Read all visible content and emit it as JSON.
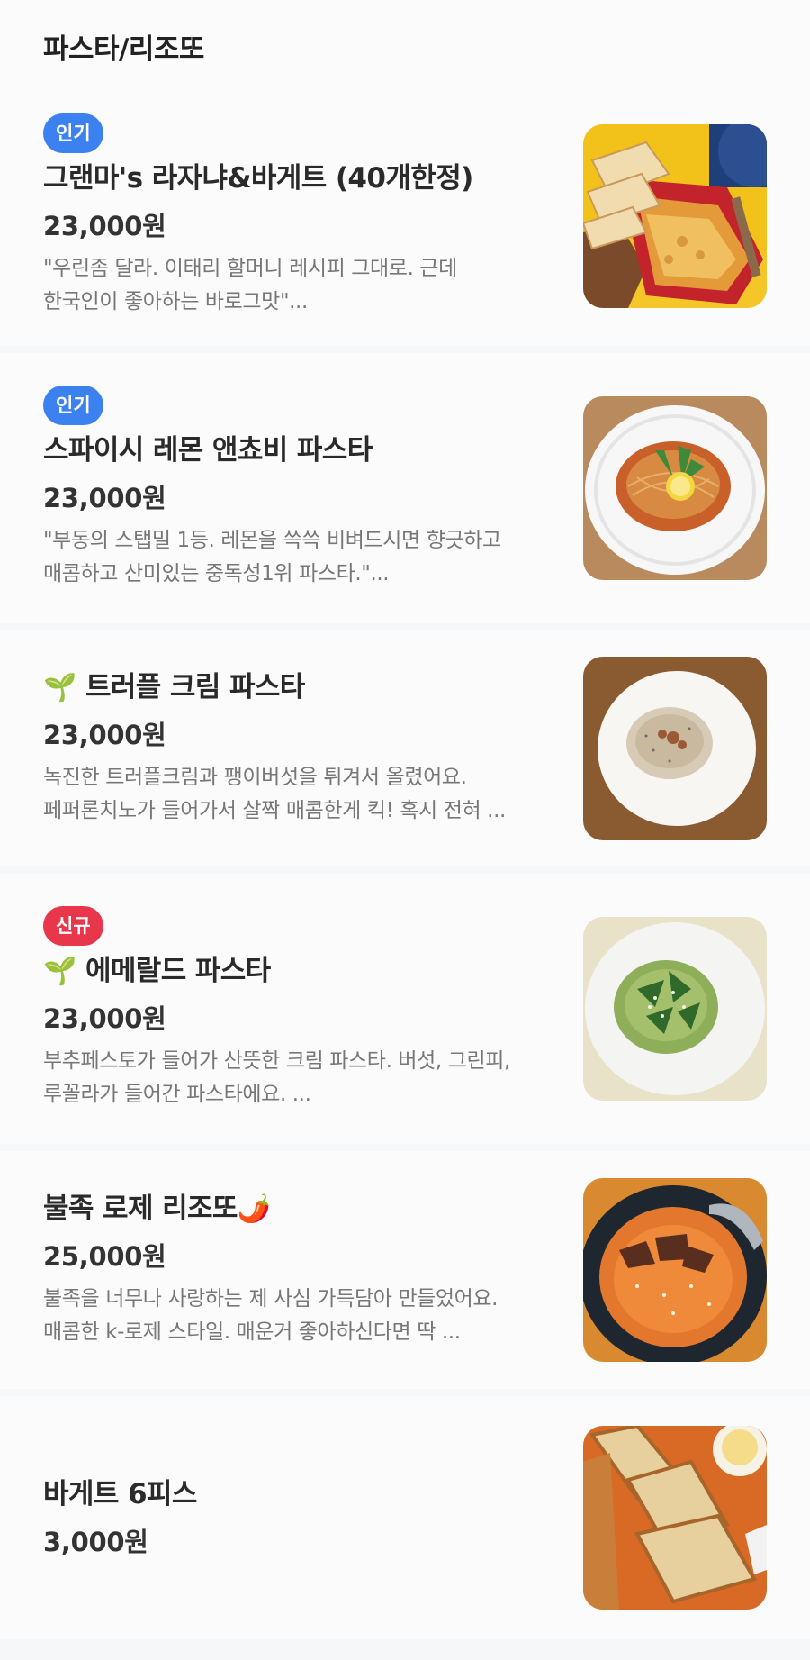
{
  "section": {
    "title": "파스타/리조또"
  },
  "items": [
    {
      "badge": "인기",
      "name": "그랜마's 라자냐&바게트 (40개한정)",
      "price": "23,000원",
      "desc1": "\"우린좀 달라. 이태리 할머니 레시피 그대로. 근데",
      "desc2": "한국인이 좋아하는 바로그맛\"...",
      "image": "lasagna-baguette-photo"
    },
    {
      "badge": "인기",
      "name": "스파이시 레몬 앤쵸비 파스타",
      "price": "23,000원",
      "desc1": "\"부동의 스탭밀 1등. 레몬을 쓱쓱 비벼드시면 향긋하고",
      "desc2": "매콤하고 산미있는 중독성1위 파스타.\"...",
      "image": "lemon-anchovy-pasta-photo"
    },
    {
      "emoji": "🌱",
      "name": "트러플 크림 파스타",
      "price": "23,000원",
      "desc1": "녹진한 트러플크림과 팽이버섯을 튀겨서 올렸어요.",
      "desc2": "페퍼론치노가 들어가서 살짝 매콤한게 킥! 혹시 전혀 ...",
      "image": "truffle-cream-pasta-photo"
    },
    {
      "badge": "신규",
      "emoji": "🌱",
      "name": "에메랄드 파스타",
      "price": "23,000원",
      "desc1": "부추페스토가 들어가 산뜻한 크림 파스타. 버섯, 그린피,",
      "desc2": "루꼴라가 들어간 파스타에요. ...",
      "image": "emerald-pasta-photo"
    },
    {
      "name": "불족 로제 리조또",
      "emoji_after": "🌶️",
      "price": "25,000원",
      "desc1": "불족을 너무나 사랑하는 제 사심 가득담아 만들었어요.",
      "desc2": "매콤한 k-로제 스타일. 매운거 좋아하신다면 딱 ...",
      "image": "rose-risotto-photo"
    },
    {
      "name": "바게트 6피스",
      "price": "3,000원",
      "image": "baguette-photo"
    }
  ],
  "colors": {
    "badge_popular": "#3b82f0",
    "badge_new": "#e8364a"
  }
}
